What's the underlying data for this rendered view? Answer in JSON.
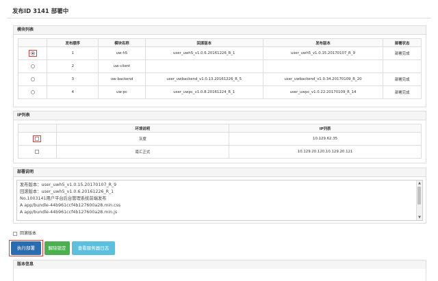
{
  "page_title": "发布ID 3141 部署中",
  "module_list": {
    "heading": "模块列表",
    "columns": [
      "",
      "发布顺序",
      "模块名称",
      "回滚版本",
      "发布版本",
      "部署状态"
    ],
    "rows": [
      {
        "selected": true,
        "order": "1",
        "name": "uw-h5",
        "rollback": "user_uwh5_v1.0.6.20161226_R_1",
        "release": "user_uwh5_v1.0.15.20170107_R_9",
        "status": "部署完成"
      },
      {
        "selected": false,
        "order": "2",
        "name": "uw-client",
        "rollback": "",
        "release": "",
        "status": ""
      },
      {
        "selected": false,
        "order": "3",
        "name": "uw-backend",
        "rollback": "user_uwbackend_v1.0.13.20161226_R_5",
        "release": "user_uwbackend_v1.0.34.20170109_R_20",
        "status": "部署完成"
      },
      {
        "selected": false,
        "order": "4",
        "name": "uw-pc",
        "rollback": "user_uwpc_v1.0.8.20161224_R_1",
        "release": "user_uwpc_v1.0.22.20170109_R_14",
        "status": "部署完成"
      }
    ]
  },
  "ip_list": {
    "heading": "IP列表",
    "columns": [
      "",
      "环境说明",
      "IP列表"
    ],
    "rows": [
      {
        "env": "灰度",
        "ips": "10.129.62.35"
      },
      {
        "env": "南汇正式",
        "ips": "10.129.20.120,10.129.20.121"
      }
    ]
  },
  "deploy_notes": {
    "heading": "部署说明",
    "lines": [
      "发布版本：user_uwh5_v1.0.15.20170107_R_9",
      "回滚版本：user_uwh5_v1.0.6.20161226_R_1",
      "No.1003141用户平台后台管理系统前端发布",
      "A     app/bundle-44b961ccf4b127600a28.min.css",
      "A     app/bundle-44b961ccf4b127600a28.min.js"
    ]
  },
  "rollback_label": "回滚版本",
  "buttons": {
    "execute": "执行部署",
    "unlock": "解除锁定",
    "view_log": "查看服务器日志"
  },
  "version_info_heading": "版本信息",
  "colors": {
    "execute": "#2b6cb0",
    "unlock": "#4caf50",
    "view_log": "#5bc0de",
    "highlight": "#e53935"
  }
}
